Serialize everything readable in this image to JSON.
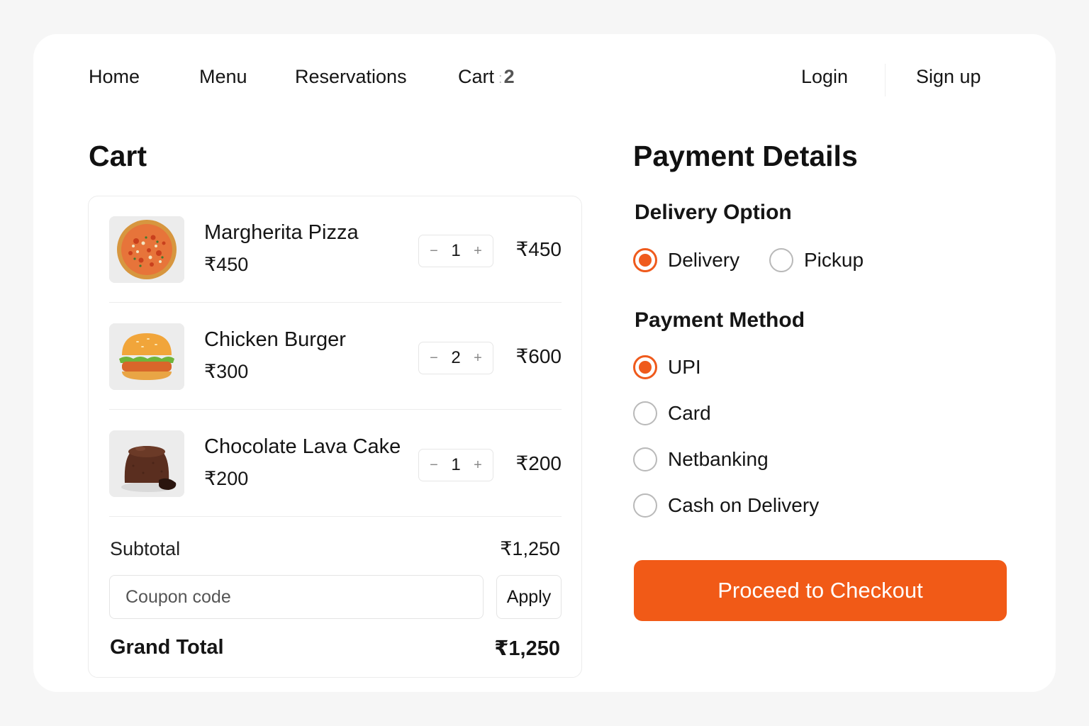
{
  "nav": {
    "home": "Home",
    "menu": "Menu",
    "reservations": "Reservations",
    "cart": "Cart",
    "cart_count": "2",
    "login": "Login",
    "signup": "Sign up"
  },
  "cart": {
    "title": "Cart",
    "items": [
      {
        "name": "Margherita Pizza",
        "price": "₹450",
        "qty": "1",
        "total": "₹450",
        "icon": "pizza-image"
      },
      {
        "name": "Chicken Burger",
        "price": "₹300",
        "qty": "2",
        "total": "₹600",
        "icon": "burger-image"
      },
      {
        "name": "Chocolate Lava Cake",
        "price": "₹200",
        "qty": "1",
        "total": "₹200",
        "icon": "lava-cake-image"
      }
    ],
    "stepper": {
      "minus": "−",
      "plus": "+"
    },
    "subtotal_label": "Subtotal",
    "subtotal_value": "₹1,250",
    "coupon_placeholder": "Coupon code",
    "apply_label": "Apply",
    "grand_total_label": "Grand Total",
    "grand_total_value": "₹1,250"
  },
  "payment": {
    "title": "Payment Details",
    "delivery_heading": "Delivery Option",
    "delivery_options": [
      {
        "label": "Delivery",
        "selected": true
      },
      {
        "label": "Pickup",
        "selected": false
      }
    ],
    "method_heading": "Payment Method",
    "methods": [
      {
        "label": "UPI",
        "selected": true
      },
      {
        "label": "Card",
        "selected": false
      },
      {
        "label": "Netbanking",
        "selected": false
      },
      {
        "label": "Cash on Delivery",
        "selected": false
      }
    ],
    "checkout_label": "Proceed to Checkout"
  },
  "colors": {
    "accent": "#f15a17",
    "background": "#f6f6f6",
    "card": "#ffffff"
  }
}
